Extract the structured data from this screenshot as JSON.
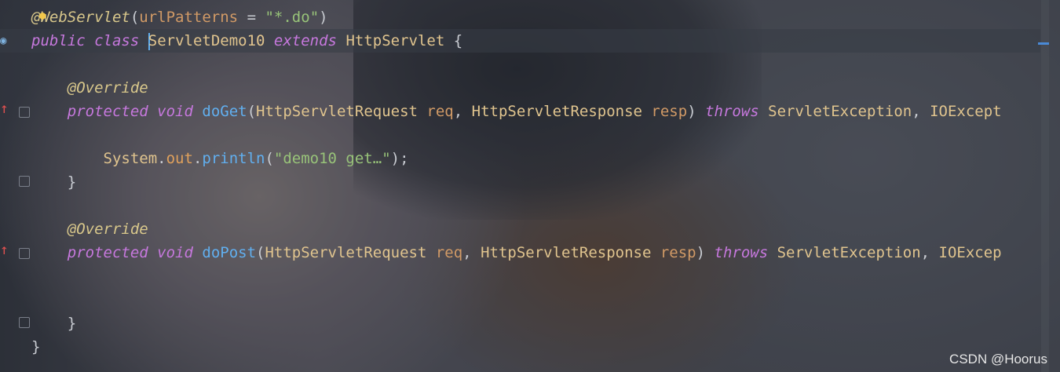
{
  "editor": {
    "lines": [
      {
        "id": "l1",
        "tokens": [
          [
            "ann",
            "@"
          ],
          [
            "ann",
            "WebServlet"
          ],
          [
            "plain",
            "("
          ],
          [
            "par",
            "urlPatterns"
          ],
          [
            "plain",
            " = "
          ],
          [
            "str",
            "\""
          ],
          [
            "str",
            "*.do"
          ],
          [
            "str",
            "\""
          ],
          [
            "plain",
            ")"
          ]
        ]
      },
      {
        "id": "l2",
        "tokens": [
          [
            "kw",
            "public"
          ],
          [
            "plain",
            " "
          ],
          [
            "kw",
            "class"
          ],
          [
            "plain",
            " "
          ],
          [
            "cls",
            "ServletDemo10"
          ],
          [
            "plain",
            " "
          ],
          [
            "kw",
            "extends"
          ],
          [
            "plain",
            " "
          ],
          [
            "cls",
            "HttpServlet"
          ],
          [
            "plain",
            " {"
          ]
        ]
      },
      {
        "id": "l3",
        "tokens": []
      },
      {
        "id": "l4",
        "tokens": [
          [
            "plain",
            "    "
          ],
          [
            "ann",
            "@Override"
          ]
        ]
      },
      {
        "id": "l5",
        "tokens": [
          [
            "plain",
            "    "
          ],
          [
            "kw",
            "protected"
          ],
          [
            "plain",
            " "
          ],
          [
            "kw",
            "void"
          ],
          [
            "plain",
            " "
          ],
          [
            "fn",
            "doGet"
          ],
          [
            "plain",
            "("
          ],
          [
            "cls",
            "HttpServletRequest"
          ],
          [
            "plain",
            " "
          ],
          [
            "par",
            "req"
          ],
          [
            "plain",
            ", "
          ],
          [
            "cls",
            "HttpServletResponse"
          ],
          [
            "plain",
            " "
          ],
          [
            "par",
            "resp"
          ],
          [
            "plain",
            ") "
          ],
          [
            "kw",
            "throws"
          ],
          [
            "plain",
            " "
          ],
          [
            "cls",
            "ServletException"
          ],
          [
            "plain",
            ", "
          ],
          [
            "cls",
            "IOExcept"
          ]
        ]
      },
      {
        "id": "l6",
        "tokens": []
      },
      {
        "id": "l7",
        "tokens": [
          [
            "plain",
            "        "
          ],
          [
            "cls",
            "System"
          ],
          [
            "plain",
            "."
          ],
          [
            "fld",
            "out"
          ],
          [
            "plain",
            "."
          ],
          [
            "fn",
            "println"
          ],
          [
            "plain",
            "("
          ],
          [
            "str",
            "\"demo10 get…\""
          ],
          [
            "plain",
            ");"
          ]
        ]
      },
      {
        "id": "l8",
        "tokens": [
          [
            "plain",
            "    }"
          ]
        ]
      },
      {
        "id": "l9",
        "tokens": []
      },
      {
        "id": "l10",
        "tokens": [
          [
            "plain",
            "    "
          ],
          [
            "ann",
            "@Override"
          ]
        ]
      },
      {
        "id": "l11",
        "tokens": [
          [
            "plain",
            "    "
          ],
          [
            "kw",
            "protected"
          ],
          [
            "plain",
            " "
          ],
          [
            "kw",
            "void"
          ],
          [
            "plain",
            " "
          ],
          [
            "fn",
            "doPost"
          ],
          [
            "plain",
            "("
          ],
          [
            "cls",
            "HttpServletRequest"
          ],
          [
            "plain",
            " "
          ],
          [
            "par",
            "req"
          ],
          [
            "plain",
            ", "
          ],
          [
            "cls",
            "HttpServletResponse"
          ],
          [
            "plain",
            " "
          ],
          [
            "par",
            "resp"
          ],
          [
            "plain",
            ") "
          ],
          [
            "kw",
            "throws"
          ],
          [
            "plain",
            " "
          ],
          [
            "cls",
            "ServletException"
          ],
          [
            "plain",
            ", "
          ],
          [
            "cls",
            "IOExcep"
          ]
        ]
      },
      {
        "id": "l12",
        "tokens": []
      },
      {
        "id": "l13",
        "tokens": []
      },
      {
        "id": "l14",
        "tokens": [
          [
            "plain",
            "    }"
          ]
        ]
      },
      {
        "id": "l15",
        "tokens": [
          [
            "plain",
            "}"
          ]
        ]
      }
    ]
  },
  "watermark": "CSDN @Hoorus",
  "colors": {
    "keyword": "#c678dd",
    "annotation": "#d8c78b",
    "class": "#e0c48e",
    "function": "#61afef",
    "param": "#d19a66",
    "string": "#98c379"
  },
  "icons": [
    "bulb-icon",
    "override-arrow-icon",
    "fold-marker-icon"
  ]
}
